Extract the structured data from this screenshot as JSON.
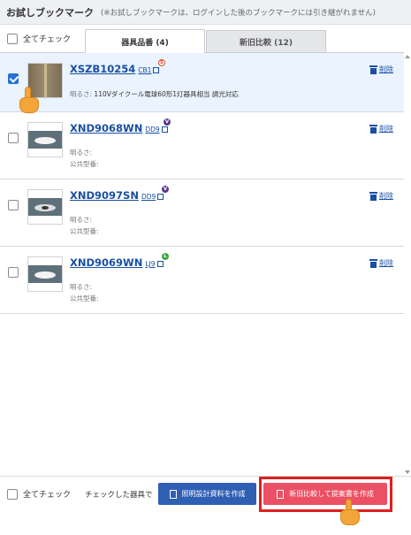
{
  "header": {
    "title": "お試しブックマーク",
    "note": "(※お試しブックマークは、ログインした後のブックマークには引き継がれません)"
  },
  "top": {
    "check_all": "全てチェック",
    "tabs": [
      {
        "label": "器具品番 (4)",
        "active": true
      },
      {
        "label": "新旧比較 (12)",
        "active": false
      }
    ]
  },
  "items": [
    {
      "code": "XSZB10254",
      "sub": "CB1",
      "badge": "S",
      "badge_color": "#e24a2b",
      "checked": true,
      "brightness_label": "明るさ:",
      "brightness_value": "110Vダイクール電球60形1灯器具相当 調光対応",
      "public_label": "",
      "delete": "削除"
    },
    {
      "code": "XND9068WN",
      "sub": "DD9",
      "badge": "V",
      "badge_color": "#5a3a8a",
      "checked": false,
      "brightness_label": "明るさ:",
      "brightness_value": "",
      "public_label": "公共型番:",
      "delete": "削除"
    },
    {
      "code": "XND9097SN",
      "sub": "DD9",
      "badge": "V",
      "badge_color": "#5a3a8a",
      "checked": false,
      "brightness_label": "明るさ:",
      "brightness_value": "",
      "public_label": "公共型番:",
      "delete": "削除"
    },
    {
      "code": "XND9069WN",
      "sub": "LJ9",
      "badge": "L",
      "badge_color": "#3aa640",
      "checked": false,
      "brightness_label": "明るさ:",
      "brightness_value": "",
      "public_label": "公共型番:",
      "delete": "削除"
    }
  ],
  "footer": {
    "check_all": "全てチェック",
    "checked_label": "チェックした器具で",
    "design_button": "照明設計資料を作成",
    "proposal_button": "新旧比較して提案書を作成"
  },
  "colors": {
    "accent_blue": "#2f5fb3",
    "proposal_red": "#ec5064",
    "highlight_frame": "#e01e1e",
    "link_blue": "#1a4fa3"
  }
}
